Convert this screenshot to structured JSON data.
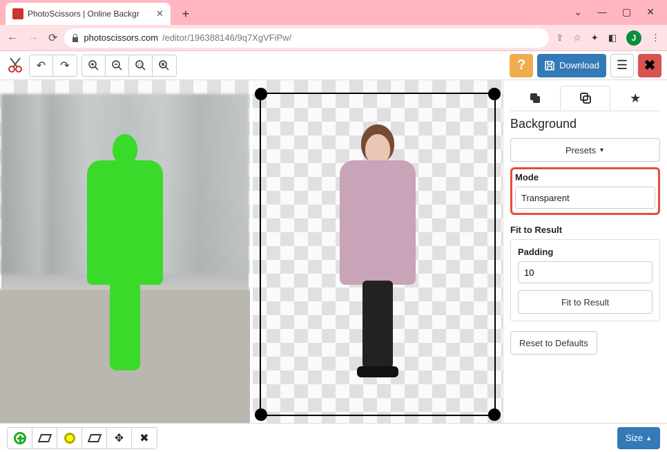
{
  "browser": {
    "tab_title": "PhotoScissors | Online Backgr",
    "url_domain": "photoscissors.com",
    "url_path": "/editor/196388146/9q7XgVFiPw/",
    "avatar_letter": "J"
  },
  "toolbar": {
    "download_label": "Download"
  },
  "panel": {
    "heading": "Background",
    "presets_label": "Presets",
    "mode_label": "Mode",
    "mode_value": "Transparent",
    "fit_heading": "Fit to Result",
    "padding_label": "Padding",
    "padding_value": "10",
    "fit_button": "Fit to Result",
    "reset_button": "Reset to Defaults"
  },
  "bottom": {
    "size_label": "Size"
  }
}
